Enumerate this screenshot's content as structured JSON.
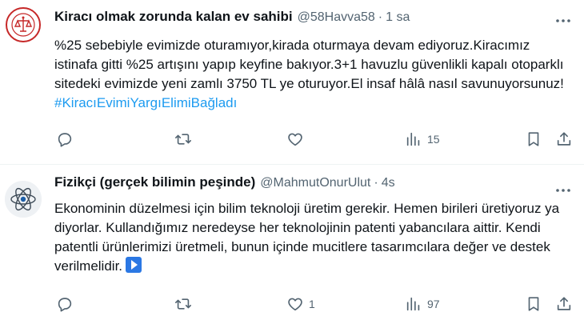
{
  "tweets": [
    {
      "display_name": "Kiracı olmak zorunda kalan ev sahibi",
      "handle": "@58Havva58",
      "separator": "·",
      "time": "1 sa",
      "text_main": "%25 sebebiyle evimizde oturamıyor,kirada oturmaya devam ediyoruz.Kiracımız istinafa gitti %25 artışını yapıp keyfine bakıyor.3+1 havuzlu güvenlikli kapalı otoparklı sitedeki evimizde yeni zamlı 3750 TL ye oturuyor.El insaf hâlâ nasıl savunuyorsunuz! ",
      "hashtag": "#KiracıEvimiYargıElimiBağladı",
      "actions": {
        "reply": "",
        "retweet": "",
        "like": "",
        "views": "15"
      }
    },
    {
      "display_name": "Fizikçi (gerçek bilimin peşinde)",
      "handle": "@MahmutOnurUlut",
      "separator": "·",
      "time": "4s",
      "text_main": "Ekonominin düzelmesi için bilim teknoloji üretim gerekir. Hemen birileri üretiyoruz ya diyorlar. Kullandığımız neredeyse her teknolojinin patenti yabancılara aittir. Kendi patentli ürünlerimizi üretmeli, bunun içinde mucitlere tasarımcılara değer ve destek verilmelidir.",
      "actions": {
        "reply": "",
        "retweet": "",
        "like": "1",
        "views": "97"
      }
    }
  ],
  "colors": {
    "text": "#0f1419",
    "muted": "#536471",
    "link": "#1d9bf0",
    "divider": "#eff3f4",
    "avatar_red": "#c62828"
  },
  "icons": [
    "reply-icon",
    "retweet-icon",
    "like-icon",
    "views-icon",
    "bookmark-icon",
    "share-icon",
    "more-icon",
    "play-icon"
  ]
}
